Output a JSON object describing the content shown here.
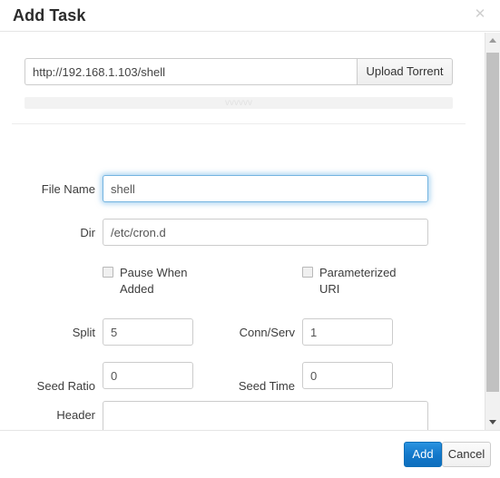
{
  "dialog": {
    "title": "Add Task",
    "close_icon": "close-icon",
    "close_glyph": "✕"
  },
  "url_row": {
    "value": "http://192.168.1.103/shell",
    "placeholder": "",
    "upload_button": "Upload Torrent"
  },
  "handle": {
    "chevrons": "vvvvvv"
  },
  "form": {
    "file_name": {
      "label": "File Name",
      "value": "shell",
      "focused": true
    },
    "dir": {
      "label": "Dir",
      "value": "/etc/cron.d"
    },
    "pause_when_added": {
      "label": "Pause When Added",
      "checked": false
    },
    "parameterized_uri": {
      "label": "Parameterized URI",
      "checked": false
    },
    "split": {
      "label": "Split",
      "value": "5"
    },
    "conn_serv": {
      "label": "Conn/Serv",
      "value": "1"
    },
    "seed_ratio": {
      "label": "Seed Ratio",
      "value": "0"
    },
    "seed_time": {
      "label": "Seed Time",
      "value": "0"
    },
    "header": {
      "label": "Header",
      "value": "",
      "placeholder": ""
    }
  },
  "footer": {
    "add_label": "Add",
    "cancel_label": "Cancel"
  },
  "scrollbar": {
    "up_icon": "caret-up-icon",
    "down_icon": "caret-down-icon"
  },
  "colors": {
    "accent_blue": "#1277c9",
    "focus_blue": "#74b4e0",
    "border_gray": "#cccccc",
    "text_dark": "#333333"
  }
}
